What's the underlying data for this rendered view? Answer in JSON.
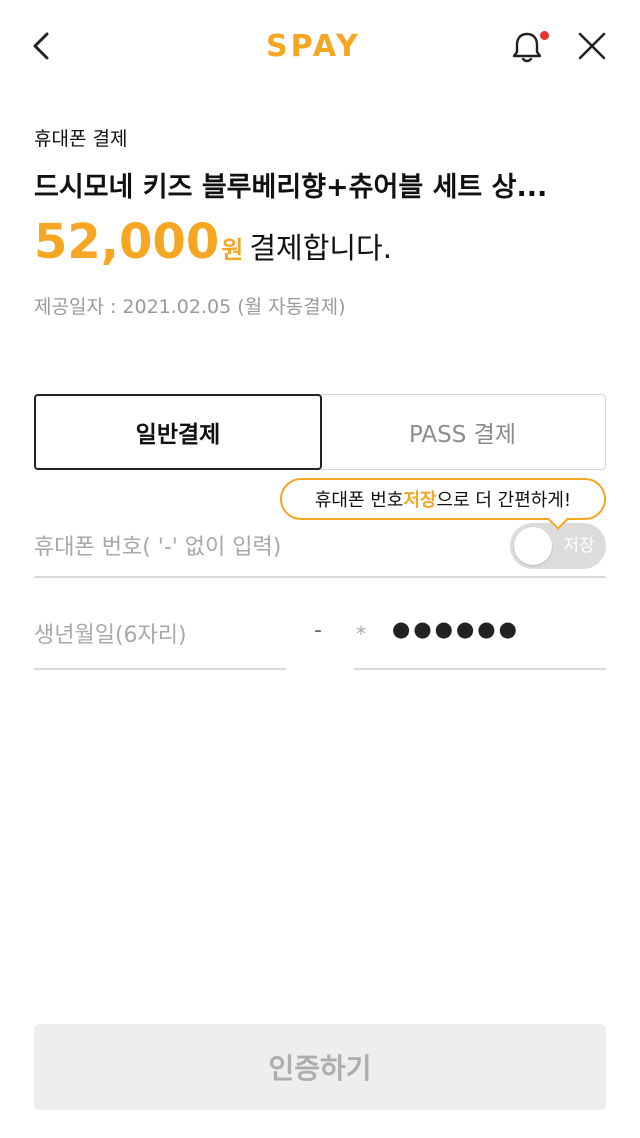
{
  "header": {
    "logo_text": "SPAY",
    "back_icon": "chevron-left-icon",
    "bell_icon": "bell-icon",
    "close_icon": "close-icon",
    "notification_dot_color": "#e8332e"
  },
  "product": {
    "payment_type": "휴대폰 결제",
    "title": "드시모네 키즈 블루베리향+츄어블 세트 상...",
    "price_amount": "52,000",
    "price_unit": "원",
    "price_suffix": "결제합니다.",
    "provide_date": "제공일자 : 2021.02.05 (월 자동결제)"
  },
  "tabs": [
    {
      "label": "일반결제",
      "selected": true
    },
    {
      "label": "PASS 결제",
      "selected": false
    }
  ],
  "tooltip": {
    "prefix": "휴대폰 번호 ",
    "highlight": "저장",
    "suffix": "으로 더 간편하게!"
  },
  "form": {
    "phone_placeholder": "휴대폰 번호( '-' 없이 입력)",
    "save_toggle_label": "저장",
    "save_toggle_on": false,
    "birth_placeholder": "생년월일(6자리)",
    "separator": "-",
    "gender_placeholder": "*",
    "masked_digits": "●●●●●●"
  },
  "footer": {
    "auth_button_label": "인증하기"
  },
  "colors": {
    "accent": "#f5a623",
    "disabled_bg": "#eeeeee",
    "disabled_text": "#adadad"
  }
}
